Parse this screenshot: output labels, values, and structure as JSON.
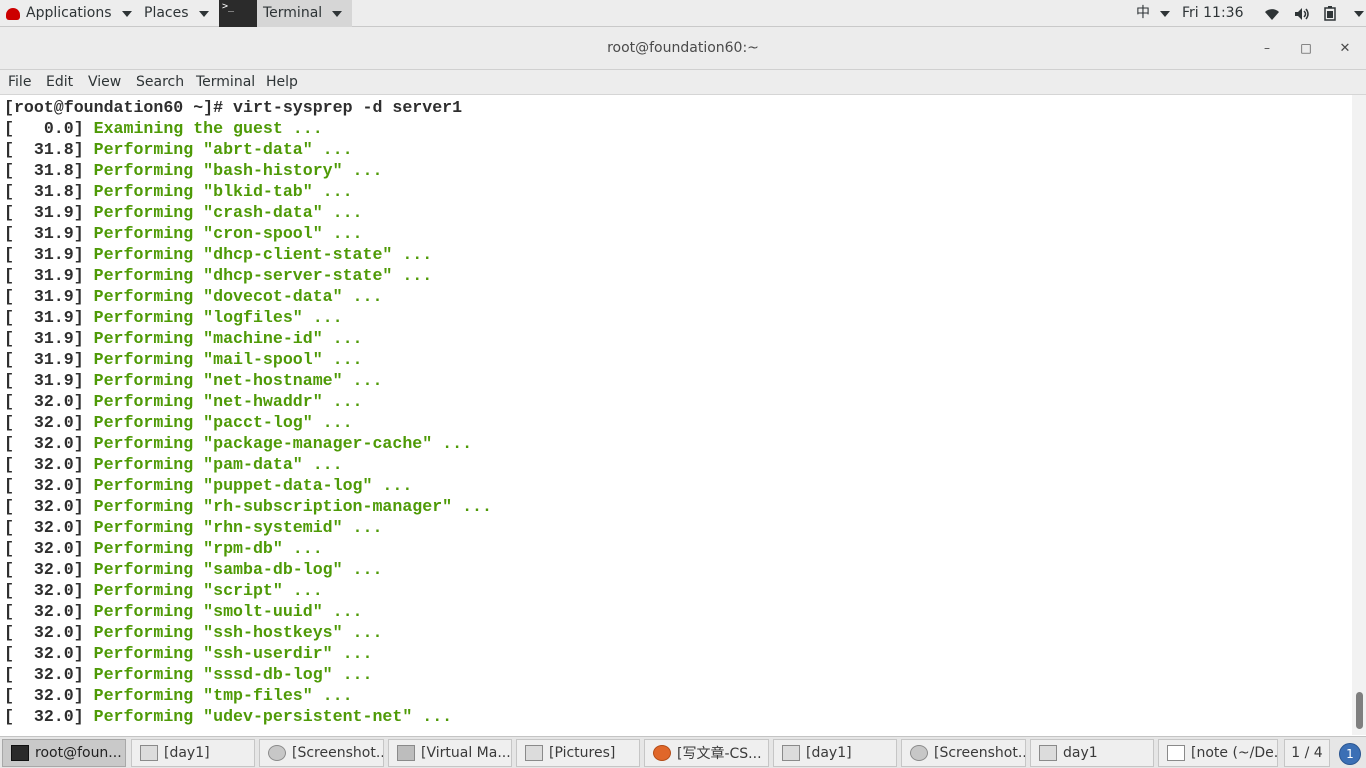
{
  "top_panel": {
    "applications": "Applications",
    "places": "Places",
    "active_app": "Terminal",
    "input_method": "中",
    "clock": "Fri 11:36"
  },
  "window": {
    "title": "root@foundation60:~",
    "minimize": "–",
    "maximize": "□",
    "close": "✕"
  },
  "menu": [
    "File",
    "Edit",
    "View",
    "Search",
    "Terminal",
    "Help"
  ],
  "terminal": {
    "prompt": "[root@foundation60 ~]# ",
    "command": "virt-sysprep -d server1",
    "lines": [
      {
        "time": "[   0.0] ",
        "msg": "Examining the guest ..."
      },
      {
        "time": "[  31.8] ",
        "msg": "Performing \"abrt-data\" ..."
      },
      {
        "time": "[  31.8] ",
        "msg": "Performing \"bash-history\" ..."
      },
      {
        "time": "[  31.8] ",
        "msg": "Performing \"blkid-tab\" ..."
      },
      {
        "time": "[  31.9] ",
        "msg": "Performing \"crash-data\" ..."
      },
      {
        "time": "[  31.9] ",
        "msg": "Performing \"cron-spool\" ..."
      },
      {
        "time": "[  31.9] ",
        "msg": "Performing \"dhcp-client-state\" ..."
      },
      {
        "time": "[  31.9] ",
        "msg": "Performing \"dhcp-server-state\" ..."
      },
      {
        "time": "[  31.9] ",
        "msg": "Performing \"dovecot-data\" ..."
      },
      {
        "time": "[  31.9] ",
        "msg": "Performing \"logfiles\" ..."
      },
      {
        "time": "[  31.9] ",
        "msg": "Performing \"machine-id\" ..."
      },
      {
        "time": "[  31.9] ",
        "msg": "Performing \"mail-spool\" ..."
      },
      {
        "time": "[  31.9] ",
        "msg": "Performing \"net-hostname\" ..."
      },
      {
        "time": "[  32.0] ",
        "msg": "Performing \"net-hwaddr\" ..."
      },
      {
        "time": "[  32.0] ",
        "msg": "Performing \"pacct-log\" ..."
      },
      {
        "time": "[  32.0] ",
        "msg": "Performing \"package-manager-cache\" ..."
      },
      {
        "time": "[  32.0] ",
        "msg": "Performing \"pam-data\" ..."
      },
      {
        "time": "[  32.0] ",
        "msg": "Performing \"puppet-data-log\" ..."
      },
      {
        "time": "[  32.0] ",
        "msg": "Performing \"rh-subscription-manager\" ..."
      },
      {
        "time": "[  32.0] ",
        "msg": "Performing \"rhn-systemid\" ..."
      },
      {
        "time": "[  32.0] ",
        "msg": "Performing \"rpm-db\" ..."
      },
      {
        "time": "[  32.0] ",
        "msg": "Performing \"samba-db-log\" ..."
      },
      {
        "time": "[  32.0] ",
        "msg": "Performing \"script\" ..."
      },
      {
        "time": "[  32.0] ",
        "msg": "Performing \"smolt-uuid\" ..."
      },
      {
        "time": "[  32.0] ",
        "msg": "Performing \"ssh-hostkeys\" ..."
      },
      {
        "time": "[  32.0] ",
        "msg": "Performing \"ssh-userdir\" ..."
      },
      {
        "time": "[  32.0] ",
        "msg": "Performing \"sssd-db-log\" ..."
      },
      {
        "time": "[  32.0] ",
        "msg": "Performing \"tmp-files\" ..."
      },
      {
        "time": "[  32.0] ",
        "msg": "Performing \"udev-persistent-net\" ..."
      }
    ]
  },
  "taskbar": {
    "tasks": [
      {
        "label": "root@foun...",
        "icon": "terminal-icon",
        "active": true
      },
      {
        "label": "[day1]",
        "icon": "document-icon",
        "active": false
      },
      {
        "label": "[Screenshot...",
        "icon": "screenshot-icon",
        "active": false
      },
      {
        "label": "[Virtual Ma...",
        "icon": "virtual-machine-icon",
        "active": false
      },
      {
        "label": "[Pictures]",
        "icon": "folder-icon",
        "active": false
      },
      {
        "label": "[写文章-CS...",
        "icon": "firefox-icon",
        "active": false
      },
      {
        "label": "[day1]",
        "icon": "document-icon",
        "active": false
      },
      {
        "label": "[Screenshot...",
        "icon": "screenshot-icon",
        "active": false
      },
      {
        "label": "day1",
        "icon": "document-icon",
        "active": false
      },
      {
        "label": "[note (~/De...",
        "icon": "text-editor-icon",
        "active": false
      }
    ],
    "workspace": "1 / 4",
    "notifications": "1"
  },
  "colors": {
    "terminal_message": "#4e9a06",
    "terminal_text": "#2e2e2e"
  }
}
